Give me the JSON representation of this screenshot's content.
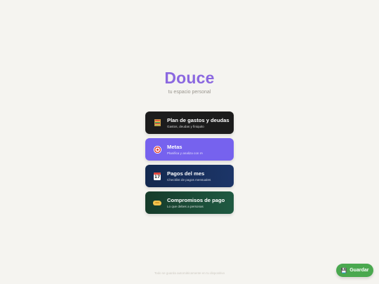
{
  "header": {
    "title": "Douce",
    "subtitle": "tu espacio personal"
  },
  "menu": {
    "items": [
      {
        "title": "Plan de gastos y deudas",
        "description": "Gastos, deudas y finiquito",
        "icon": "abacus-icon",
        "color": "#1c1c1c"
      },
      {
        "title": "Metas",
        "description": "Planifica y analiza con IA",
        "icon": "target-icon",
        "color": "#7662ee"
      },
      {
        "title": "Pagos del mes",
        "description": "Checklist de pagos mensuales",
        "icon": "calendar-icon",
        "color": "#13294f"
      },
      {
        "title": "Compromisos de pago",
        "description": "Lo que debes a personas",
        "icon": "handshake-icon",
        "color": "#163b2a"
      }
    ]
  },
  "footer": {
    "note": "Todo se guarda automáticamente en tu dispositivo"
  },
  "save_button": {
    "label": "Guardar",
    "icon": "floppy-disk-icon",
    "color": "#4aa84f"
  }
}
